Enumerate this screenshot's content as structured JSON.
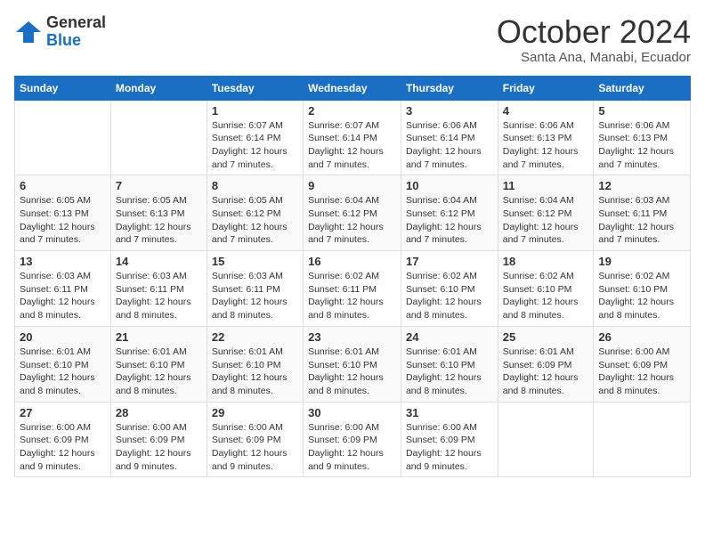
{
  "logo": {
    "general": "General",
    "blue": "Blue"
  },
  "header": {
    "month": "October 2024",
    "location": "Santa Ana, Manabi, Ecuador"
  },
  "days_of_week": [
    "Sunday",
    "Monday",
    "Tuesday",
    "Wednesday",
    "Thursday",
    "Friday",
    "Saturday"
  ],
  "weeks": [
    [
      {
        "day": "",
        "info": ""
      },
      {
        "day": "",
        "info": ""
      },
      {
        "day": "1",
        "info": "Sunrise: 6:07 AM\nSunset: 6:14 PM\nDaylight: 12 hours and 7 minutes."
      },
      {
        "day": "2",
        "info": "Sunrise: 6:07 AM\nSunset: 6:14 PM\nDaylight: 12 hours and 7 minutes."
      },
      {
        "day": "3",
        "info": "Sunrise: 6:06 AM\nSunset: 6:14 PM\nDaylight: 12 hours and 7 minutes."
      },
      {
        "day": "4",
        "info": "Sunrise: 6:06 AM\nSunset: 6:13 PM\nDaylight: 12 hours and 7 minutes."
      },
      {
        "day": "5",
        "info": "Sunrise: 6:06 AM\nSunset: 6:13 PM\nDaylight: 12 hours and 7 minutes."
      }
    ],
    [
      {
        "day": "6",
        "info": "Sunrise: 6:05 AM\nSunset: 6:13 PM\nDaylight: 12 hours and 7 minutes."
      },
      {
        "day": "7",
        "info": "Sunrise: 6:05 AM\nSunset: 6:13 PM\nDaylight: 12 hours and 7 minutes."
      },
      {
        "day": "8",
        "info": "Sunrise: 6:05 AM\nSunset: 6:12 PM\nDaylight: 12 hours and 7 minutes."
      },
      {
        "day": "9",
        "info": "Sunrise: 6:04 AM\nSunset: 6:12 PM\nDaylight: 12 hours and 7 minutes."
      },
      {
        "day": "10",
        "info": "Sunrise: 6:04 AM\nSunset: 6:12 PM\nDaylight: 12 hours and 7 minutes."
      },
      {
        "day": "11",
        "info": "Sunrise: 6:04 AM\nSunset: 6:12 PM\nDaylight: 12 hours and 7 minutes."
      },
      {
        "day": "12",
        "info": "Sunrise: 6:03 AM\nSunset: 6:11 PM\nDaylight: 12 hours and 7 minutes."
      }
    ],
    [
      {
        "day": "13",
        "info": "Sunrise: 6:03 AM\nSunset: 6:11 PM\nDaylight: 12 hours and 8 minutes."
      },
      {
        "day": "14",
        "info": "Sunrise: 6:03 AM\nSunset: 6:11 PM\nDaylight: 12 hours and 8 minutes."
      },
      {
        "day": "15",
        "info": "Sunrise: 6:03 AM\nSunset: 6:11 PM\nDaylight: 12 hours and 8 minutes."
      },
      {
        "day": "16",
        "info": "Sunrise: 6:02 AM\nSunset: 6:11 PM\nDaylight: 12 hours and 8 minutes."
      },
      {
        "day": "17",
        "info": "Sunrise: 6:02 AM\nSunset: 6:10 PM\nDaylight: 12 hours and 8 minutes."
      },
      {
        "day": "18",
        "info": "Sunrise: 6:02 AM\nSunset: 6:10 PM\nDaylight: 12 hours and 8 minutes."
      },
      {
        "day": "19",
        "info": "Sunrise: 6:02 AM\nSunset: 6:10 PM\nDaylight: 12 hours and 8 minutes."
      }
    ],
    [
      {
        "day": "20",
        "info": "Sunrise: 6:01 AM\nSunset: 6:10 PM\nDaylight: 12 hours and 8 minutes."
      },
      {
        "day": "21",
        "info": "Sunrise: 6:01 AM\nSunset: 6:10 PM\nDaylight: 12 hours and 8 minutes."
      },
      {
        "day": "22",
        "info": "Sunrise: 6:01 AM\nSunset: 6:10 PM\nDaylight: 12 hours and 8 minutes."
      },
      {
        "day": "23",
        "info": "Sunrise: 6:01 AM\nSunset: 6:10 PM\nDaylight: 12 hours and 8 minutes."
      },
      {
        "day": "24",
        "info": "Sunrise: 6:01 AM\nSunset: 6:10 PM\nDaylight: 12 hours and 8 minutes."
      },
      {
        "day": "25",
        "info": "Sunrise: 6:01 AM\nSunset: 6:09 PM\nDaylight: 12 hours and 8 minutes."
      },
      {
        "day": "26",
        "info": "Sunrise: 6:00 AM\nSunset: 6:09 PM\nDaylight: 12 hours and 8 minutes."
      }
    ],
    [
      {
        "day": "27",
        "info": "Sunrise: 6:00 AM\nSunset: 6:09 PM\nDaylight: 12 hours and 9 minutes."
      },
      {
        "day": "28",
        "info": "Sunrise: 6:00 AM\nSunset: 6:09 PM\nDaylight: 12 hours and 9 minutes."
      },
      {
        "day": "29",
        "info": "Sunrise: 6:00 AM\nSunset: 6:09 PM\nDaylight: 12 hours and 9 minutes."
      },
      {
        "day": "30",
        "info": "Sunrise: 6:00 AM\nSunset: 6:09 PM\nDaylight: 12 hours and 9 minutes."
      },
      {
        "day": "31",
        "info": "Sunrise: 6:00 AM\nSunset: 6:09 PM\nDaylight: 12 hours and 9 minutes."
      },
      {
        "day": "",
        "info": ""
      },
      {
        "day": "",
        "info": ""
      }
    ]
  ]
}
